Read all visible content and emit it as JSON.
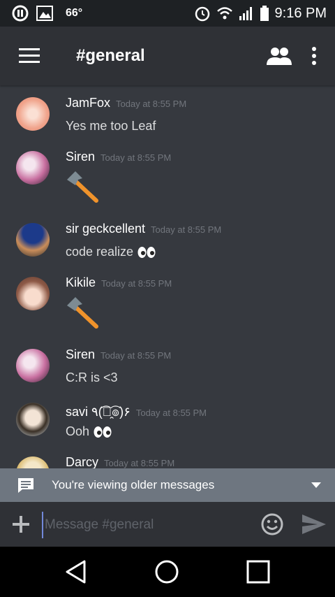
{
  "statusbar": {
    "temperature": "66°",
    "time": "9:16 PM"
  },
  "header": {
    "channel": "#general"
  },
  "messages": [
    {
      "author": "JamFox",
      "time": "Today at 8:55 PM",
      "text": "Yes me too Leaf"
    },
    {
      "author": "Siren",
      "time": "Today at 8:55 PM",
      "text": "",
      "emoji": "hammer"
    },
    {
      "author": "sir geckcellent",
      "time": "Today at 8:55 PM",
      "text": "code realize",
      "emoji": "eyes"
    },
    {
      "author": "Kikile",
      "time": "Today at 8:55 PM",
      "text": "",
      "emoji": "hammer"
    },
    {
      "author": "Siren",
      "time": "Today at 8:55 PM",
      "text": "C:R is <3"
    },
    {
      "author": "savi ٩(͡๏̯͡๏)۶",
      "time": "Today at 8:55 PM",
      "text": "Ooh",
      "emoji": "eyes"
    },
    {
      "author": "Darcy",
      "time": "Today at 8:55 PM",
      "text": ""
    }
  ],
  "banner": {
    "text": "You're viewing older messages"
  },
  "composer": {
    "placeholder": "Message #general"
  },
  "colors": {
    "background": "#36393f",
    "header": "#2f3136",
    "banner": "#6e7680",
    "accent": "#7289da"
  }
}
